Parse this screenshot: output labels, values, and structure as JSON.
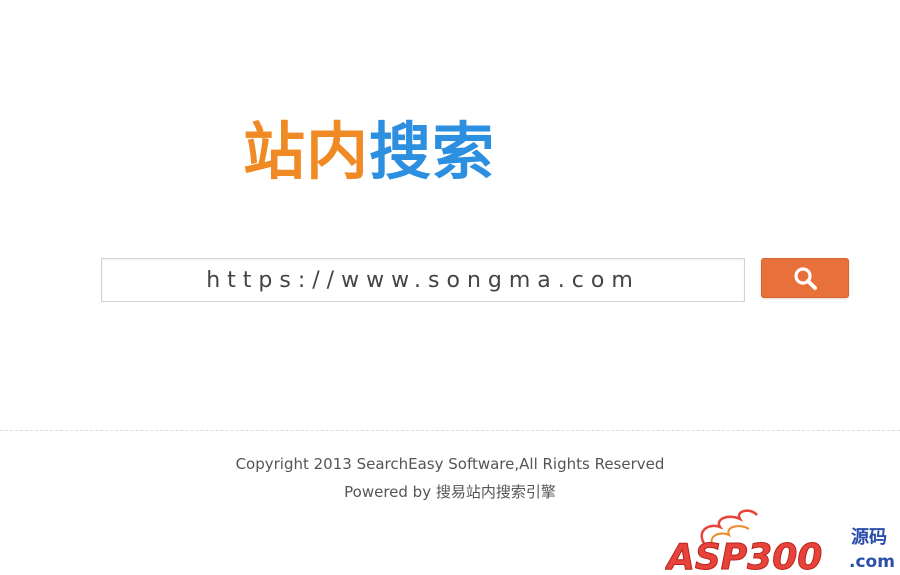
{
  "logo": {
    "part_a": "站内",
    "part_b": "搜索",
    "colors": {
      "part_a": "#f08a24",
      "part_b": "#2d8fe0"
    }
  },
  "search": {
    "placeholder": "https://www.songma.com",
    "button_icon": "search-icon",
    "button_color": "#e8703a"
  },
  "footer": {
    "copyright": "Copyright 2013 SearchEasy Software,All Rights Reserved",
    "powered": "Powered by 搜易站内搜索引擎"
  },
  "watermark": {
    "text_main": "ASP300",
    "text_side": "源码",
    "text_com": ".com"
  }
}
